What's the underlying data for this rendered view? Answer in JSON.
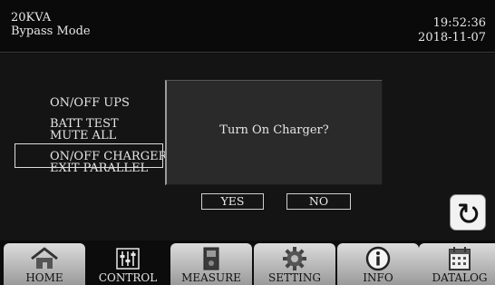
{
  "header": {
    "rating": "20KVA",
    "mode": "Bypass Mode",
    "time": "19:52:36",
    "date": "2018-11-07"
  },
  "menu": {
    "items": [
      {
        "label": "ON/OFF UPS"
      },
      {
        "label": "BATT TEST"
      },
      {
        "label": "MUTE ALL"
      },
      {
        "label": "ON/OFF CHARGER",
        "selected": true
      },
      {
        "label": "EXIT PARALLEL"
      }
    ]
  },
  "dialog": {
    "message": "Turn On Charger?",
    "yes_label": "YES",
    "no_label": "NO"
  },
  "back_button": {
    "icon": "refresh-icon"
  },
  "nav": {
    "tabs": [
      {
        "label": "HOME",
        "icon": "home-icon"
      },
      {
        "label": "CONTROL",
        "icon": "sliders-icon",
        "active": true
      },
      {
        "label": "MEASURE",
        "icon": "meter-icon"
      },
      {
        "label": "SETTING",
        "icon": "gear-icon"
      },
      {
        "label": "INFO",
        "icon": "info-icon"
      },
      {
        "label": "DATALOG",
        "icon": "calendar-icon"
      }
    ]
  }
}
